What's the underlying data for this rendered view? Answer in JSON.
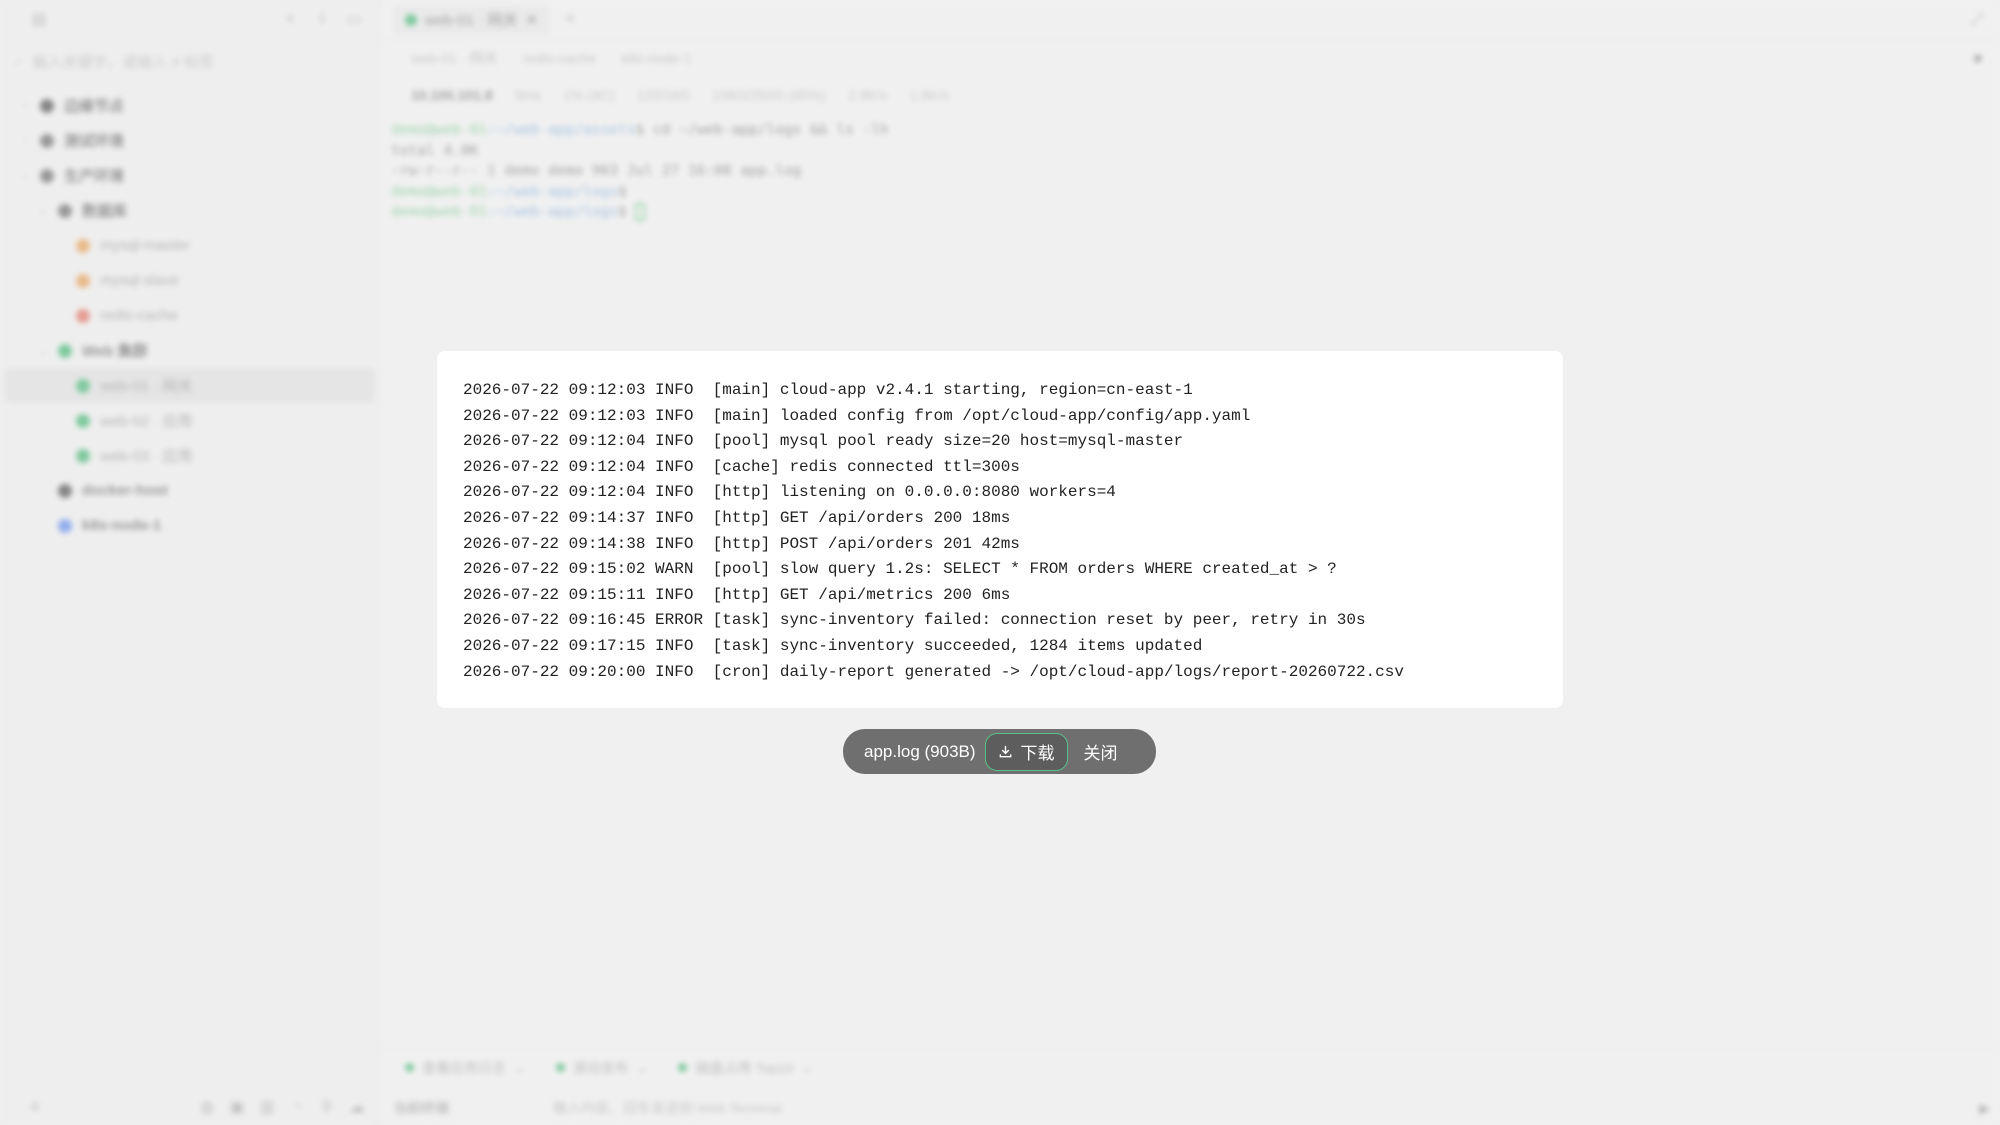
{
  "sidebar": {
    "search_placeholder": "输入关键字，或输入 # 标签",
    "tree": [
      {
        "label": "边缘节点",
        "color": "#333333",
        "level": 0,
        "chevron": "›"
      },
      {
        "label": "测试环境",
        "color": "#555555",
        "level": 0,
        "chevron": "›"
      },
      {
        "label": "生产环境",
        "color": "#555555",
        "level": 0,
        "chevron": "⌄"
      },
      {
        "label": "数据库",
        "color": "#555555",
        "level": 1,
        "chevron": "⌄"
      },
      {
        "label": "mysql-master",
        "color": "#e8923a",
        "level": 2,
        "chevron": ""
      },
      {
        "label": "mysql-slave",
        "color": "#e8923a",
        "level": 2,
        "chevron": ""
      },
      {
        "label": "redis-cache",
        "color": "#e05a4a",
        "level": 2,
        "chevron": ""
      },
      {
        "label": "Web 集群",
        "color": "#27ae60",
        "level": 1,
        "chevron": "⌄"
      },
      {
        "label": "web-01 · 网关",
        "color": "#27ae60",
        "level": 2,
        "chevron": "",
        "active": true
      },
      {
        "label": "web-02 · 应用",
        "color": "#27ae60",
        "level": 2,
        "chevron": ""
      },
      {
        "label": "web-03 · 应用",
        "color": "#27ae60",
        "level": 2,
        "chevron": ""
      },
      {
        "label": "docker-host",
        "color": "#333333",
        "level": 1,
        "chevron": ""
      },
      {
        "label": "k8s-node-1",
        "color": "#4a7cf0",
        "level": 1,
        "chevron": ""
      }
    ]
  },
  "tabs": {
    "active_label": "web-01 · 网关"
  },
  "breadcrumbs": [
    "web-01 · 网关",
    "redis-cache",
    "k8s-node-1"
  ],
  "status": {
    "host": "10.100.101.8",
    "latency": "9ms",
    "cpu": "1% (4C)",
    "memory": "120/16G",
    "disk": "106G/250G (45%)",
    "upload": "2.9K/s",
    "download": "1.6K/s"
  },
  "terminal": {
    "prompt_user": "demo@web-01",
    "line1_path": ":~/web-app/assets",
    "line1_cmd": "$ cd ~/web-app/logs && ls -lh",
    "line2": "total 4.0K",
    "line3": "-rw-r--r-- 1 demo demo 903 Jul 27 16:08 app.log",
    "line4_path": ":~/web-app/logs",
    "line4_end": "$",
    "line5_path": ":~/web-app/logs",
    "line5_end": "$ "
  },
  "quick_actions": [
    "查看应用日志",
    "滚动发布",
    "磁盘占用 Top10"
  ],
  "cmd": {
    "target": "当前终端",
    "placeholder": "输入内容，回车发送到 Web Terminal"
  },
  "log": {
    "lines": [
      "2026-07-22 09:12:03 INFO  [main] cloud-app v2.4.1 starting, region=cn-east-1",
      "2026-07-22 09:12:03 INFO  [main] loaded config from /opt/cloud-app/config/app.yaml",
      "2026-07-22 09:12:04 INFO  [pool] mysql pool ready size=20 host=mysql-master",
      "2026-07-22 09:12:04 INFO  [cache] redis connected ttl=300s",
      "2026-07-22 09:12:04 INFO  [http] listening on 0.0.0.0:8080 workers=4",
      "2026-07-22 09:14:37 INFO  [http] GET /api/orders 200 18ms",
      "2026-07-22 09:14:38 INFO  [http] POST /api/orders 201 42ms",
      "2026-07-22 09:15:02 WARN  [pool] slow query 1.2s: SELECT * FROM orders WHERE created_at > ?",
      "2026-07-22 09:15:11 INFO  [http] GET /api/metrics 200 6ms",
      "2026-07-22 09:16:45 ERROR [task] sync-inventory failed: connection reset by peer, retry in 30s",
      "2026-07-22 09:17:15 INFO  [task] sync-inventory succeeded, 1284 items updated",
      "2026-07-22 09:20:00 INFO  [cron] daily-report generated -> /opt/cloud-app/logs/report-20260722.csv"
    ]
  },
  "file_bar": {
    "filename": "app.log (903B)",
    "download_label": "下载",
    "close_label": "关闭"
  }
}
